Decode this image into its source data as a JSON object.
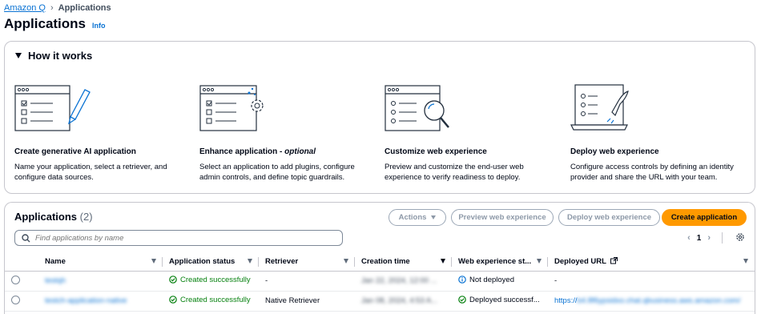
{
  "breadcrumb": {
    "root": "Amazon Q",
    "current": "Applications"
  },
  "page": {
    "title": "Applications",
    "info": "Info"
  },
  "how_it_works": {
    "title": "How it works",
    "steps": [
      {
        "title": "Create generative AI application",
        "title_suffix": "",
        "desc": "Name your application, select a retriever, and configure data sources."
      },
      {
        "title": "Enhance application - ",
        "title_suffix": "optional",
        "desc": "Select an application to add plugins, configure admin controls, and define topic guardrails."
      },
      {
        "title": "Customize web experience",
        "title_suffix": "",
        "desc": "Preview and customize the end-user web experience to verify readiness to deploy."
      },
      {
        "title": "Deploy web experience",
        "title_suffix": "",
        "desc": "Configure access controls by defining an identity provider and share the URL with your team."
      }
    ]
  },
  "apps": {
    "title": "Applications",
    "count": "(2)",
    "buttons": {
      "actions": "Actions",
      "preview": "Preview web experience",
      "deploy": "Deploy web experience",
      "create": "Create application"
    },
    "search_placeholder": "Find applications by name",
    "page_number": "1",
    "columns": [
      "Name",
      "Application status",
      "Retriever",
      "Creation time",
      "Web experience st...",
      "Deployed URL"
    ],
    "rows": [
      {
        "name": "testqh",
        "status": "Created successfully",
        "retriever": "-",
        "created": "Jan 22, 2024, 12:00 ...",
        "web_status": "Not deployed",
        "url": "-"
      },
      {
        "name": "testch-application-native",
        "status": "Created successfully",
        "retriever": "Native Retriever",
        "created": "Jan 08, 2024, 4:53 A...",
        "web_status": "Deployed successf...",
        "url": "https://",
        "url_blur": "b4.8f6ypsidxo.chat.qbusiness.aws.amazon.com/"
      }
    ]
  },
  "colors": {
    "link": "#0972d3",
    "primary": "#ff9900",
    "success": "#037f0c",
    "info": "#0972d3"
  }
}
